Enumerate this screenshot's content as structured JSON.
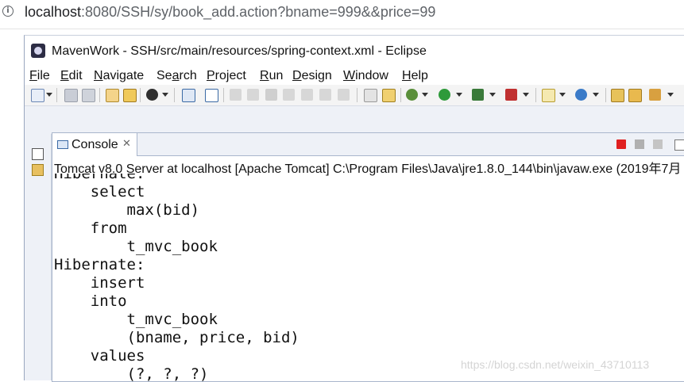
{
  "browser": {
    "url_host": "localhost",
    "url_rest": ":8080/SSH/sy/book_add.action?bname=999&&price=99",
    "info_icon": "i"
  },
  "window": {
    "title": "MavenWork - SSH/src/main/resources/spring-context.xml - Eclipse"
  },
  "menu": [
    {
      "first": "F",
      "rest": "ile"
    },
    {
      "first": "E",
      "rest": "dit"
    },
    {
      "first": "N",
      "rest": "avigate"
    },
    {
      "first": "",
      "mid": "S",
      "rest": "e",
      "label": "Search"
    },
    {
      "first": "P",
      "rest": "roject"
    },
    {
      "first": "R",
      "rest": "un"
    },
    {
      "first": "D",
      "rest": "esign"
    },
    {
      "first": "W",
      "rest": "indow"
    },
    {
      "first": "H",
      "rest": "elp"
    }
  ],
  "menu_labels": {
    "file": [
      "F",
      "ile"
    ],
    "edit": [
      "E",
      "dit"
    ],
    "navigate": [
      "N",
      "avigate"
    ],
    "search": [
      "S",
      "e",
      "a",
      "rch"
    ],
    "project": [
      "P",
      "roject"
    ],
    "run": [
      "R",
      "un"
    ],
    "design": [
      "D",
      "esign"
    ],
    "window": [
      "W",
      "indow"
    ],
    "help": [
      "H",
      "elp"
    ]
  },
  "console": {
    "tab_label": "Console",
    "close_glyph": "✕",
    "process": "Tomcat v8.0 Server at localhost [Apache Tomcat] C:\\Program Files\\Java\\jre1.8.0_144\\bin\\javaw.exe (2019年7月",
    "lines": [
      "Hibernate:",
      "    select",
      "        max(bid)",
      "    from",
      "        t_mvc_book",
      "Hibernate:",
      "    insert",
      "    into",
      "        t_mvc_book",
      "        (bname, price, bid)",
      "    values",
      "        (?, ?, ?)"
    ]
  },
  "watermark": "https://blog.csdn.net/weixin_43710113",
  "colors": {
    "stop": "#e02020",
    "accent": "#3b6aa5"
  }
}
